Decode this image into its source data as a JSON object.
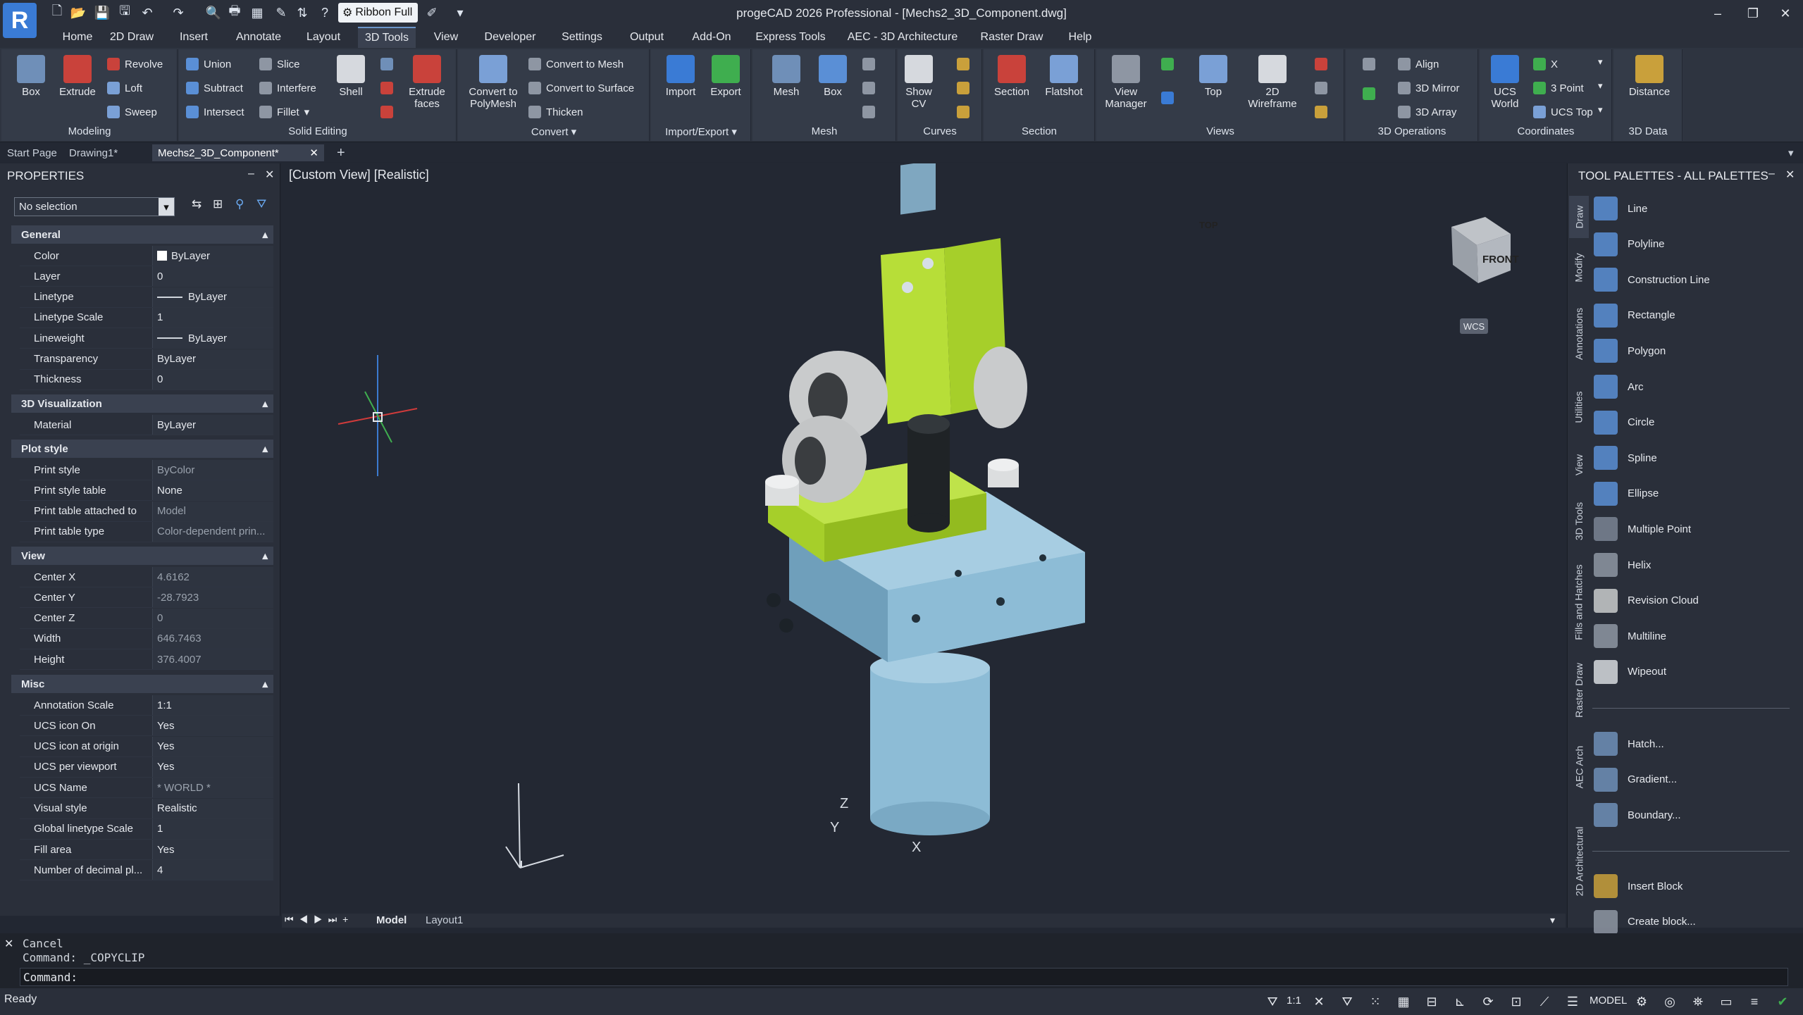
{
  "app": {
    "title": "progeCAD 2026 Professional - [Mechs2_3D_Component.dwg]",
    "logo": "R",
    "ribbon_mode": "Ribbon Full",
    "win_buttons": [
      "–",
      "❐",
      "✕"
    ]
  },
  "quick_access": [
    "new-icon",
    "open-icon",
    "save-icon",
    "saveas-icon",
    "undo-icon",
    "redo-icon",
    "print-preview-icon",
    "print-icon",
    "table-icon",
    "brush-icon",
    "help-icon"
  ],
  "menu_tabs": [
    "Home",
    "2D Draw",
    "Insert",
    "Annotate",
    "Layout",
    "3D Tools",
    "View",
    "Developer",
    "Settings",
    "Output",
    "Add-On",
    "Express Tools",
    "AEC - 3D Architecture",
    "Raster Draw",
    "Help"
  ],
  "active_tab": "3D Tools",
  "ribbon": {
    "panels": [
      "Modeling",
      "Solid Editing",
      "Convert",
      "Import/Export",
      "Mesh",
      "Curves",
      "Section",
      "Views",
      "3D Operations",
      "Coordinates",
      "3D Data"
    ],
    "modeling": {
      "box": "Box",
      "extrude": "Extrude",
      "revolve": "Revolve",
      "loft": "Loft",
      "sweep": "Sweep"
    },
    "solid_editing": {
      "union": "Union",
      "subtract": "Subtract",
      "intersect": "Intersect",
      "slice": "Slice",
      "interfere": "Interfere",
      "fillet": "Fillet",
      "shell": "Shell",
      "extrude_faces_1": "Extrude",
      "extrude_faces_2": "faces"
    },
    "convert": {
      "to_polymesh_1": "Convert to",
      "to_polymesh_2": "PolyMesh",
      "to_mesh": "Convert to Mesh",
      "to_surface": "Convert to Surface",
      "thicken": "Thicken"
    },
    "import_export": {
      "import": "Import",
      "export": "Export"
    },
    "mesh": {
      "mesh": "Mesh",
      "box": "Box"
    },
    "curves": {
      "show_cv_1": "Show",
      "show_cv_2": "CV"
    },
    "section": {
      "section": "Section",
      "flatshot": "Flatshot"
    },
    "views": {
      "view_manager_1": "View",
      "view_manager_2": "Manager",
      "top": "Top",
      "wire_1": "2D",
      "wire_2": "Wireframe"
    },
    "operations": {
      "align": "Align",
      "mirror": "3D Mirror",
      "array": "3D Array"
    },
    "coordinates": {
      "ucs_world_1": "UCS",
      "ucs_world_2": "World",
      "x": "X",
      "three_point": "3 Point",
      "ucs_top": "UCS Top"
    },
    "data": {
      "distance": "Distance"
    }
  },
  "doc_tabs": [
    "Start Page",
    "Drawing1*",
    "Mechs2_3D_Component*"
  ],
  "properties": {
    "title": "PROPERTIES",
    "selection": "No selection",
    "sections": {
      "general": "General",
      "vis": "3D Visualization",
      "plot": "Plot style",
      "view": "View",
      "misc": "Misc"
    },
    "general": [
      [
        "Color",
        "ByLayer"
      ],
      [
        "Layer",
        "0"
      ],
      [
        "Linetype",
        "ByLayer"
      ],
      [
        "Linetype Scale",
        "1"
      ],
      [
        "Lineweight",
        "ByLayer"
      ],
      [
        "Transparency",
        "ByLayer"
      ],
      [
        "Thickness",
        "0"
      ]
    ],
    "vis": [
      [
        "Material",
        "ByLayer"
      ]
    ],
    "plot": [
      [
        "Print style",
        "ByColor"
      ],
      [
        "Print style table",
        "None"
      ],
      [
        "Print table attached to",
        "Model"
      ],
      [
        "Print table type",
        "Color-dependent prin..."
      ]
    ],
    "view": [
      [
        "Center X",
        "4.6162"
      ],
      [
        "Center Y",
        "-28.7923"
      ],
      [
        "Center Z",
        "0"
      ],
      [
        "Width",
        "646.7463"
      ],
      [
        "Height",
        "376.4007"
      ]
    ],
    "misc": [
      [
        "Annotation Scale",
        "1:1"
      ],
      [
        "UCS icon On",
        "Yes"
      ],
      [
        "UCS icon at origin",
        "Yes"
      ],
      [
        "UCS per viewport",
        "Yes"
      ],
      [
        "UCS Name",
        "* WORLD *"
      ],
      [
        "Visual style",
        "Realistic"
      ],
      [
        "Global linetype Scale",
        "1"
      ],
      [
        "Fill area",
        "Yes"
      ],
      [
        "Number of decimal pl...",
        "4"
      ]
    ]
  },
  "viewport": {
    "label": "[Custom View]  [Realistic]",
    "viewcube_top": "TOP",
    "viewcube_front": "FRONT",
    "wcs": "WCS",
    "axes": {
      "x": "X",
      "y": "Y",
      "z": "Z"
    }
  },
  "palette": {
    "title": "TOOL PALETTES - ALL PALETTES",
    "tabs": [
      "Draw",
      "Modify",
      "Annotations",
      "Utilities",
      "View",
      "3D Tools",
      "Fills and Hatches",
      "Raster Draw",
      "AEC Arch",
      "2D Architectural"
    ],
    "tools": [
      "Line",
      "Polyline",
      "Construction Line",
      "Rectangle",
      "Polygon",
      "Arc",
      "Circle",
      "Spline",
      "Ellipse",
      "Multiple Point",
      "Helix",
      "Revision Cloud",
      "Multiline",
      "Wipeout",
      "Hatch...",
      "Gradient...",
      "Boundary...",
      "Insert Block",
      "Create block..."
    ]
  },
  "layout_tabs": [
    "Model",
    "Layout1"
  ],
  "command": {
    "lines": [
      "Cancel",
      "Command: _COPYCLIP"
    ],
    "prompt": "Command:"
  },
  "status": {
    "ready": "Ready",
    "scale": "1:1",
    "model": "MODEL"
  },
  "colors": {
    "accent": "#3a7bd5",
    "part_green": "#a6cf2a",
    "part_blue": "#8dbcd6",
    "part_grey": "#c9cbcc",
    "bg": "#222732"
  }
}
